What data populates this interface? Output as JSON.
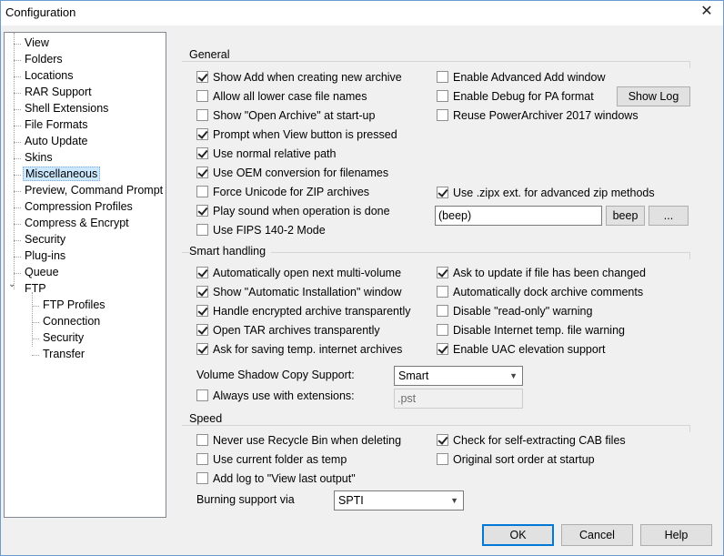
{
  "window": {
    "title": "Configuration",
    "close_glyph": "✕"
  },
  "tree": {
    "items": [
      {
        "label": "View"
      },
      {
        "label": "Folders"
      },
      {
        "label": "Locations"
      },
      {
        "label": "RAR Support"
      },
      {
        "label": "Shell Extensions"
      },
      {
        "label": "File Formats"
      },
      {
        "label": "Auto Update"
      },
      {
        "label": "Skins"
      },
      {
        "label": "Miscellaneous",
        "selected": true
      },
      {
        "label": "Preview, Command Prompt"
      },
      {
        "label": "Compression Profiles"
      },
      {
        "label": "Compress & Encrypt"
      },
      {
        "label": "Security"
      },
      {
        "label": "Plug-ins"
      },
      {
        "label": "Queue"
      },
      {
        "label": "FTP",
        "expanded": true
      },
      {
        "label": "FTP Profiles"
      },
      {
        "label": "Connection"
      },
      {
        "label": "Security"
      },
      {
        "label": "Transfer"
      }
    ],
    "expander_glyph": "⌄"
  },
  "general": {
    "title": "General",
    "left": [
      {
        "label": "Show Add when creating new archive",
        "checked": true
      },
      {
        "label": "Allow all lower case file names",
        "checked": false
      },
      {
        "label": "Show \"Open Archive\" at start-up",
        "checked": false
      },
      {
        "label": "Prompt when View button is pressed",
        "checked": true
      },
      {
        "label": "Use normal relative path",
        "checked": true
      },
      {
        "label": "Use OEM conversion for filenames",
        "checked": true
      },
      {
        "label": "Force Unicode for ZIP archives",
        "checked": false
      },
      {
        "label": "Play sound when operation is done",
        "checked": true
      },
      {
        "label": "Use FIPS 140-2 Mode",
        "checked": false
      }
    ],
    "right": [
      {
        "label": "Enable Advanced Add window",
        "checked": false
      },
      {
        "label": "Enable Debug for PA format",
        "checked": false
      },
      {
        "label": "Reuse PowerArchiver 2017 windows",
        "checked": false
      },
      {
        "label": "Use .zipx ext. for advanced zip methods",
        "checked": true
      }
    ],
    "show_log_button": "Show Log",
    "sound_value": "(beep)",
    "beep_button": "beep",
    "browse_button": "..."
  },
  "smart": {
    "title": "Smart handling",
    "left": [
      {
        "label": "Automatically open next multi-volume",
        "checked": true
      },
      {
        "label": "Show \"Automatic Installation\" window",
        "checked": true
      },
      {
        "label": "Handle encrypted archive transparently",
        "checked": true
      },
      {
        "label": "Open TAR archives transparently",
        "checked": true
      },
      {
        "label": "Ask for saving temp. internet archives",
        "checked": true
      }
    ],
    "right": [
      {
        "label": "Ask to update if file has been changed",
        "checked": true
      },
      {
        "label": "Automatically dock archive comments",
        "checked": false
      },
      {
        "label": "Disable \"read-only\" warning",
        "checked": false
      },
      {
        "label": "Disable Internet temp. file warning",
        "checked": false
      },
      {
        "label": "Enable UAC elevation support",
        "checked": true
      }
    ],
    "vss_label": "Volume Shadow Copy Support:",
    "vss_value": "Smart",
    "always_use_label": "Always use with extensions:",
    "always_use_checked": false,
    "extensions_value": ".pst"
  },
  "speed": {
    "title": "Speed",
    "left": [
      {
        "label": "Never use Recycle Bin when deleting",
        "checked": false
      },
      {
        "label": "Use current folder as temp",
        "checked": false
      },
      {
        "label": "Add log to \"View last output\"",
        "checked": false
      }
    ],
    "right": [
      {
        "label": "Check for self-extracting CAB files",
        "checked": true
      },
      {
        "label": "Original sort order at startup",
        "checked": false
      }
    ],
    "burning_label": "Burning support via",
    "burning_value": "SPTI"
  },
  "footer": {
    "ok": "OK",
    "cancel": "Cancel",
    "help": "Help"
  },
  "icons": {
    "dropdown_arrow": "chevron-down-icon"
  },
  "colors": {
    "selection": "#cce8ff",
    "default_button_border": "#0078d7"
  }
}
